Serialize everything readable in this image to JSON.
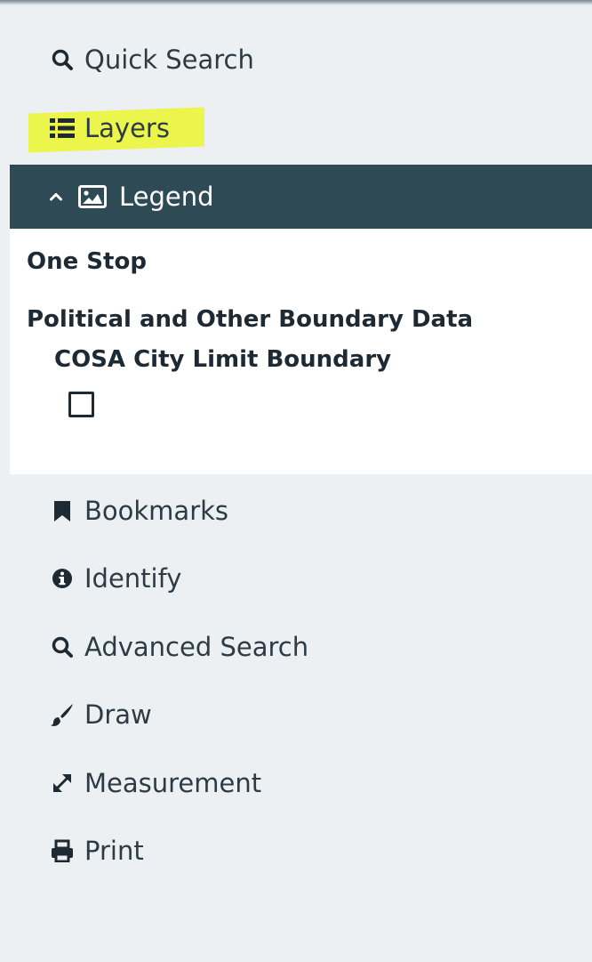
{
  "menu": {
    "quick_search": {
      "label": "Quick Search",
      "icon": "search-icon"
    },
    "layers": {
      "label": "Layers",
      "icon": "list-icon",
      "highlight_color": "#ecf54b"
    },
    "legend": {
      "label": "Legend",
      "icon": "image-icon",
      "expanded": true
    },
    "bookmarks": {
      "label": "Bookmarks",
      "icon": "bookmark-icon"
    },
    "identify": {
      "label": "Identify",
      "icon": "info-icon"
    },
    "advanced_search": {
      "label": "Advanced Search",
      "icon": "search-icon"
    },
    "draw": {
      "label": "Draw",
      "icon": "brush-icon"
    },
    "measurement": {
      "label": "Measurement",
      "icon": "expand-arrows-icon"
    },
    "print": {
      "label": "Print",
      "icon": "print-icon"
    }
  },
  "legend_content": {
    "group_one": "One Stop",
    "group_two": "Political and Other Boundary Data",
    "layer_name": "COSA City Limit Boundary"
  },
  "colors": {
    "panel_bg": "#ecf0f3",
    "header_bg": "#2e4b55",
    "text": "#2d3b45"
  }
}
